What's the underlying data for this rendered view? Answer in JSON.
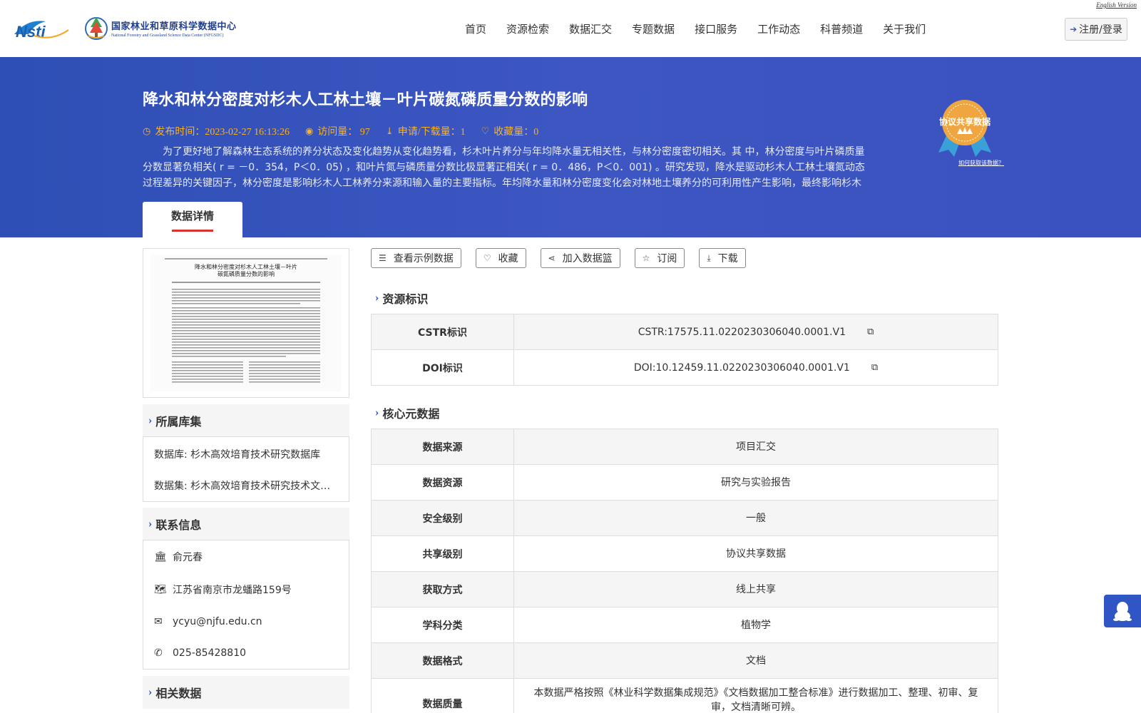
{
  "header": {
    "english_version": "English Version",
    "logo_nsti": "Nsti",
    "logo_cn": "国家林业和草原科学数据中心",
    "logo_en": "National Forestry and Grassland Science Data Center (NFGSDC)",
    "nav": [
      "首页",
      "资源检索",
      "数据汇交",
      "专题数据",
      "接口服务",
      "工作动态",
      "科普频道",
      "关于我们"
    ],
    "login_label": "注册/登录"
  },
  "banner": {
    "title": "降水和林分密度对杉木人工林土壤－叶片碳氮磷质量分数的影响",
    "publish_time": "发布时间：2023-02-27 16:13:26",
    "visits": "访问量： 97",
    "downloads": "申请/下载量：1",
    "favorites": "收藏量：0",
    "abstract": "为了更好地了解森林生态系统的养分状态及变化趋势从变化趋势看，杉木叶片养分与年均降水量无相关性，与林分密度密切相关。其 中，林分密度与叶片磷质量分数显著负相关( r = －0．354，P＜0．05) ，和叶片氮与磷质量分数比极显著正相关( r = 0．486，P＜0．001) 。研究发现，降水是驱动杉木人工林土壤氮动态过程差异的关键因子，林分密度是影响杉木人工林养分来源和输入量的主要指标。年均降水量和林分密度变化会对林地土壤养分的可利用性产生影响，最终影响杉木叶片养…",
    "badge_label": "协议共享数据",
    "how_to": "如何获取该数据？",
    "tab": "数据详情",
    "colors": {
      "banner": "#3a52bf",
      "meta": "#f5b22a",
      "tab_underline": "#d9342b",
      "badge": "#f0a640"
    }
  },
  "thumbnail": {
    "title_line1": "降水和林分密度对杉木人工林土壤－叶片",
    "title_line2": "碳氮磷质量分数的影响"
  },
  "left": {
    "collection_title": "所属库集",
    "collections": [
      "数据库: 杉木高效培育技术研究数据库",
      "数据集: 杉木高效培育技术研究技术文献数据集"
    ],
    "contact_title": "联系信息",
    "contact": {
      "name": "俞元春",
      "address": "江苏省南京市龙蟠路159号",
      "email": "ycyu@njfu.edu.cn",
      "phone": "025-85428810"
    },
    "related_title": "相关数据"
  },
  "actions": [
    "查看示例数据",
    "收藏",
    "加入数据篮",
    "订阅",
    "下载"
  ],
  "resource_id": {
    "title": "资源标识",
    "rows": [
      {
        "key": "CSTR标识",
        "value": "CSTR:17575.11.0220230306040.0001.V1"
      },
      {
        "key": "DOI标识",
        "value": "DOI:10.12459.11.0220230306040.0001.V1"
      }
    ]
  },
  "core_meta": {
    "title": "核心元数据",
    "rows": [
      {
        "key": "数据来源",
        "value": "项目汇交"
      },
      {
        "key": "数据资源",
        "value": "研究与实验报告"
      },
      {
        "key": "安全级别",
        "value": "一般"
      },
      {
        "key": "共享级别",
        "value": "协议共享数据"
      },
      {
        "key": "获取方式",
        "value": "线上共享"
      },
      {
        "key": "学科分类",
        "value": "植物学"
      },
      {
        "key": "数据格式",
        "value": "文档"
      },
      {
        "key": "数据质量",
        "value": "本数据严格按照《林业科学数据集成规范》《文档数据加工整合标准》进行数据加工、整理、初审、复审，文档清晰可辨。"
      }
    ]
  }
}
